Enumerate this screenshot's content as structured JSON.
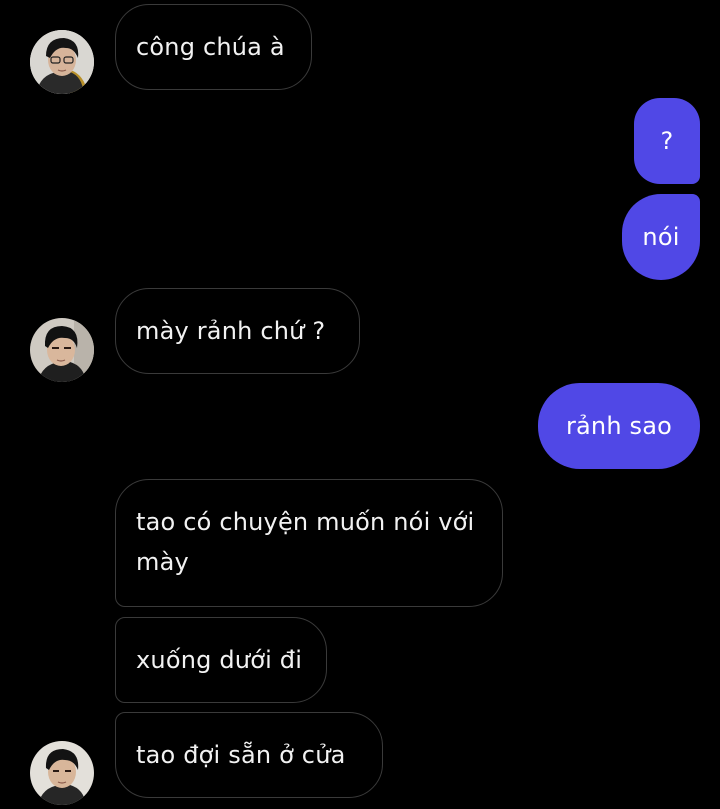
{
  "conversation": {
    "messages": [
      {
        "sender": "other",
        "text": "công chúa à"
      },
      {
        "sender": "me",
        "text": "?"
      },
      {
        "sender": "me",
        "text": "nói"
      },
      {
        "sender": "other",
        "text": "mày rảnh chứ ?"
      },
      {
        "sender": "me",
        "text": "rảnh sao"
      },
      {
        "sender": "other",
        "text": "tao có chuyện muốn nói với mày"
      },
      {
        "sender": "other",
        "text": "xuống dưới đi"
      },
      {
        "sender": "other",
        "text": "tao đợi sẵn ở cửa"
      }
    ]
  },
  "theme": {
    "background": "#000000",
    "outgoing_bubble": "#5048e6",
    "incoming_border": "#3a3a3a",
    "text": "#ffffff"
  },
  "avatar": {
    "icon": "contact-avatar-photo"
  }
}
